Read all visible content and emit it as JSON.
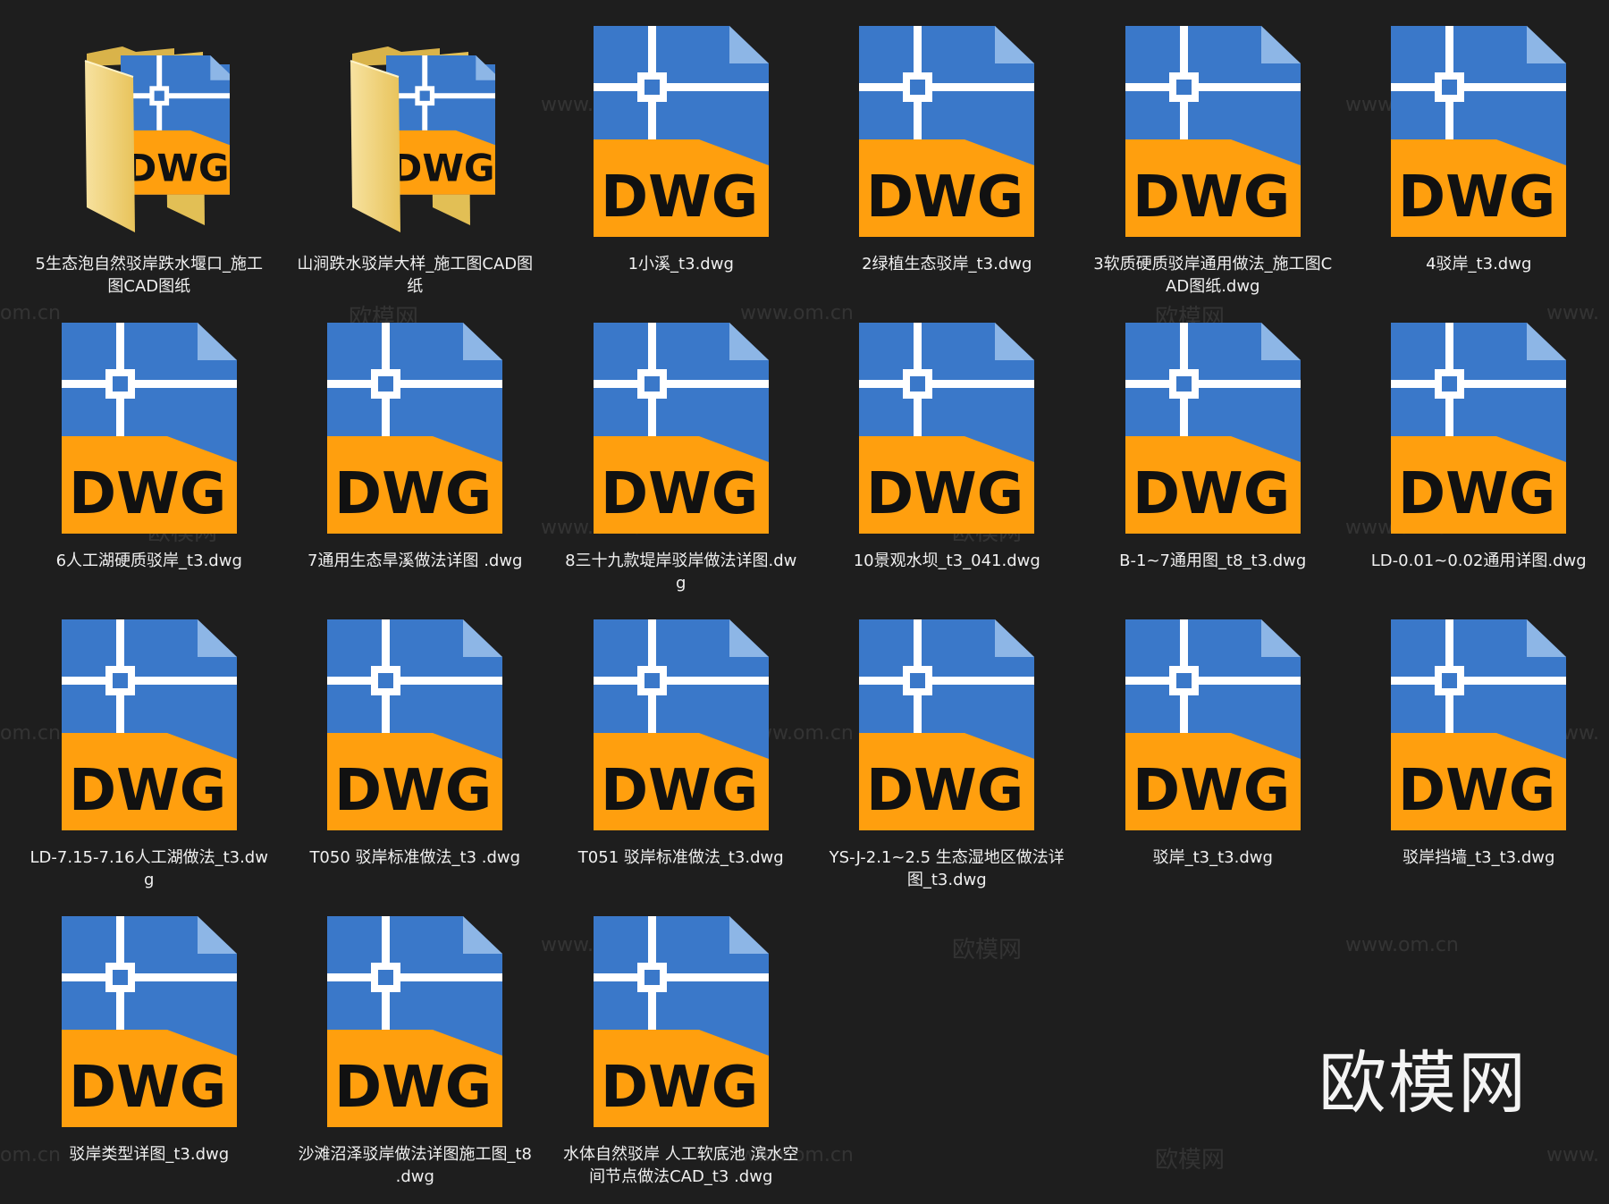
{
  "colors": {
    "background": "#1e1e1e",
    "dwg_blue": "#3a78c9",
    "dwg_fold": "#8db6e6",
    "dwg_orange": "#ff9f0e",
    "folder_yellow": "#f1d27a",
    "label_text": "#f0f0f0"
  },
  "items": [
    {
      "name": "5生态泡自然驳岸跌水堰口_施工图CAD图纸",
      "kind": "folder",
      "icon": "folder-dwg-icon"
    },
    {
      "name": "山涧跌水驳岸大样_施工图CAD图纸",
      "kind": "folder",
      "icon": "folder-dwg-icon"
    },
    {
      "name": "1小溪_t3.dwg",
      "kind": "dwg",
      "icon": "dwg-file-icon"
    },
    {
      "name": "2绿植生态驳岸_t3.dwg",
      "kind": "dwg",
      "icon": "dwg-file-icon"
    },
    {
      "name": "3软质硬质驳岸通用做法_施工图CAD图纸.dwg",
      "kind": "dwg",
      "icon": "dwg-file-icon"
    },
    {
      "name": "4驳岸_t3.dwg",
      "kind": "dwg",
      "icon": "dwg-file-icon"
    },
    {
      "name": "6人工湖硬质驳岸_t3.dwg",
      "kind": "dwg",
      "icon": "dwg-file-icon"
    },
    {
      "name": "7通用生态旱溪做法详图 .dwg",
      "kind": "dwg",
      "icon": "dwg-file-icon"
    },
    {
      "name": "8三十九款堤岸驳岸做法详图.dwg",
      "kind": "dwg",
      "icon": "dwg-file-icon"
    },
    {
      "name": "10景观水坝_t3_041.dwg",
      "kind": "dwg",
      "icon": "dwg-file-icon"
    },
    {
      "name": "B-1~7通用图_t8_t3.dwg",
      "kind": "dwg",
      "icon": "dwg-file-icon"
    },
    {
      "name": "LD-0.01~0.02通用详图.dwg",
      "kind": "dwg",
      "icon": "dwg-file-icon"
    },
    {
      "name": "LD-7.15-7.16人工湖做法_t3.dwg",
      "kind": "dwg",
      "icon": "dwg-file-icon"
    },
    {
      "name": "T050 驳岸标准做法_t3 .dwg",
      "kind": "dwg",
      "icon": "dwg-file-icon"
    },
    {
      "name": "T051  驳岸标准做法_t3.dwg",
      "kind": "dwg",
      "icon": "dwg-file-icon"
    },
    {
      "name": "YS-J-2.1~2.5 生态湿地区做法详图_t3.dwg",
      "kind": "dwg",
      "icon": "dwg-file-icon"
    },
    {
      "name": "驳岸_t3_t3.dwg",
      "kind": "dwg",
      "icon": "dwg-file-icon"
    },
    {
      "name": "驳岸挡墙_t3_t3.dwg",
      "kind": "dwg",
      "icon": "dwg-file-icon"
    },
    {
      "name": "驳岸类型详图_t3.dwg",
      "kind": "dwg",
      "icon": "dwg-file-icon"
    },
    {
      "name": "沙滩沼泽驳岸做法详图施工图_t8  .dwg",
      "kind": "dwg",
      "icon": "dwg-file-icon"
    },
    {
      "name": "水体自然驳岸 人工软底池 滨水空间节点做法CAD_t3 .dwg",
      "kind": "dwg",
      "icon": "dwg-file-icon"
    }
  ],
  "dwg_badge": "DWG",
  "watermarks": {
    "brand_text": "欧模网",
    "url_text": "www.om.cn",
    "url_partial": "om.cn",
    "url_left_partial": "www."
  }
}
